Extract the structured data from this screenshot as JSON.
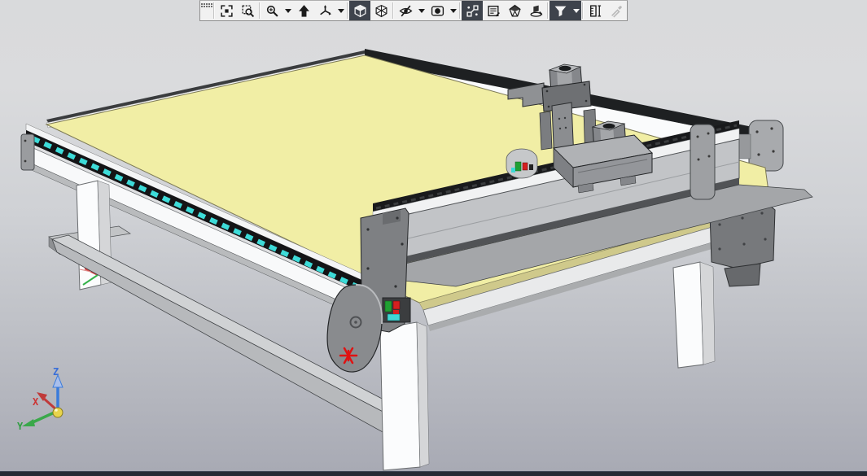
{
  "app": {
    "type": "cad-3d-viewport"
  },
  "toolbar": {
    "buttons": [
      {
        "name": "toolbar-drag-handle",
        "dropdown": false,
        "selected": false,
        "disabled": false
      },
      {
        "name": "zoom-to-fit",
        "dropdown": false,
        "selected": false,
        "disabled": false
      },
      {
        "name": "zoom-to-area",
        "dropdown": false,
        "selected": false,
        "disabled": false
      },
      {
        "name": "zoom-in-out",
        "dropdown": true,
        "selected": false,
        "disabled": false
      },
      {
        "name": "previous-view",
        "dropdown": false,
        "selected": false,
        "disabled": false
      },
      {
        "name": "view-orientation",
        "dropdown": true,
        "selected": false,
        "disabled": false
      },
      {
        "name": "display-style-shaded",
        "dropdown": false,
        "selected": true,
        "disabled": false
      },
      {
        "name": "display-style-wireframe",
        "dropdown": false,
        "selected": false,
        "disabled": false
      },
      {
        "name": "hide-show-items",
        "dropdown": true,
        "selected": false,
        "disabled": false
      },
      {
        "name": "edit-appearance",
        "dropdown": true,
        "selected": false,
        "disabled": false
      },
      {
        "name": "view-sketch-relations",
        "dropdown": false,
        "selected": true,
        "disabled": false
      },
      {
        "name": "view-annotations",
        "dropdown": false,
        "selected": false,
        "disabled": false
      },
      {
        "name": "realview-graphics",
        "dropdown": false,
        "selected": false,
        "disabled": false
      },
      {
        "name": "apply-scene",
        "dropdown": false,
        "selected": false,
        "disabled": false
      },
      {
        "name": "filter-graphics",
        "dropdown": true,
        "selected": true,
        "disabled": false
      },
      {
        "name": "measure-tool",
        "dropdown": false,
        "selected": false,
        "disabled": false
      },
      {
        "name": "color-picker",
        "dropdown": false,
        "selected": false,
        "disabled": true
      }
    ]
  },
  "viewport": {
    "triad": {
      "x_label": "X",
      "y_label": "Y",
      "z_label": "Z"
    },
    "background_top": "#d9dadc",
    "background_bottom": "#a6a8b2",
    "origin_marker_color": "#e01212"
  },
  "scene": {
    "machine": "cnc-gantry-table",
    "parts": [
      "table-top",
      "left-chain-rail",
      "right-rail",
      "gantry-beam",
      "z-carriage",
      "stepper-motor-upper",
      "stepper-motor-lower",
      "cam-wheel",
      "front-leg",
      "left-leg",
      "right-leg",
      "support-bar",
      "foot-bracket",
      "right-shuttle-plate"
    ],
    "colors": {
      "table_top": "#f1eea5",
      "rail_chain": "#3ddbd8",
      "structure_light": "#fafbfc",
      "structure_gray": "#c2c4c7",
      "accent_red": "#d42020",
      "accent_green": "#1fa032"
    }
  },
  "statusbar": {
    "color": "#262b35"
  }
}
